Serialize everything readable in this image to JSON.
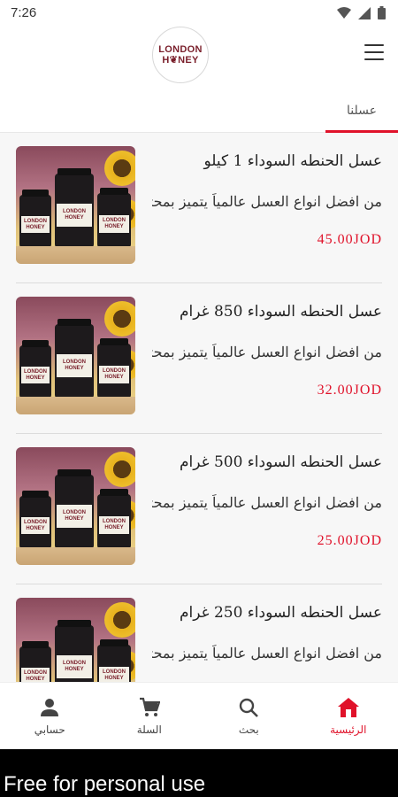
{
  "status": {
    "time": "7:26"
  },
  "header": {
    "logo_line1": "LONDON",
    "logo_line2": "H❦NEY"
  },
  "tabs": [
    {
      "label": "عسلنا"
    }
  ],
  "products": [
    {
      "title": "عسل الحنطه السوداء 1 كيلو",
      "description": "من افضل انواع العسل عالمياً يتميز بمحتوا...",
      "price": "45.00JOD"
    },
    {
      "title": "عسل الحنطه السوداء 850 غرام",
      "description": "من افضل انواع العسل عالمياً يتميز بمحتوا...",
      "price": "32.00JOD"
    },
    {
      "title": "عسل الحنطه السوداء 500 غرام",
      "description": "من افضل انواع العسل عالمياً يتميز بمحتوا...",
      "price": "25.00JOD"
    },
    {
      "title": "عسل الحنطه السوداء 250 غرام",
      "description": "من افضل انواع العسل عالمياً يتميز بمحتوا...",
      "price": ""
    }
  ],
  "bottom_nav": [
    {
      "label": "حسابي",
      "icon": "person-icon"
    },
    {
      "label": "السلة",
      "icon": "cart-icon"
    },
    {
      "label": "بحث",
      "icon": "search-icon"
    },
    {
      "label": "الرئيسية",
      "icon": "home-icon",
      "active": true
    }
  ],
  "watermark": "Free for personal use",
  "colors": {
    "accent": "#e0122a",
    "brand": "#7a1f2b"
  }
}
